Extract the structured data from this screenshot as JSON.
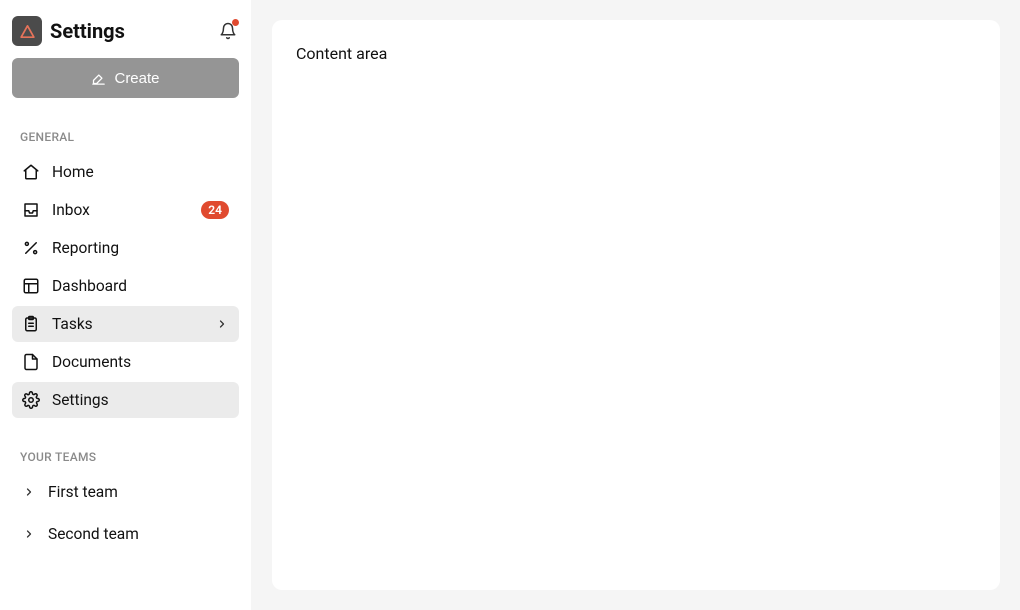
{
  "header": {
    "title": "Settings"
  },
  "create_button": {
    "label": "Create"
  },
  "sections": {
    "general_label": "GENERAL",
    "teams_label": "YOUR TEAMS"
  },
  "nav": {
    "home": "Home",
    "inbox": "Inbox",
    "inbox_badge": "24",
    "reporting": "Reporting",
    "dashboard": "Dashboard",
    "tasks": "Tasks",
    "documents": "Documents",
    "settings": "Settings"
  },
  "teams": [
    {
      "label": "First team"
    },
    {
      "label": "Second team"
    }
  ],
  "content": {
    "text": "Content area"
  }
}
